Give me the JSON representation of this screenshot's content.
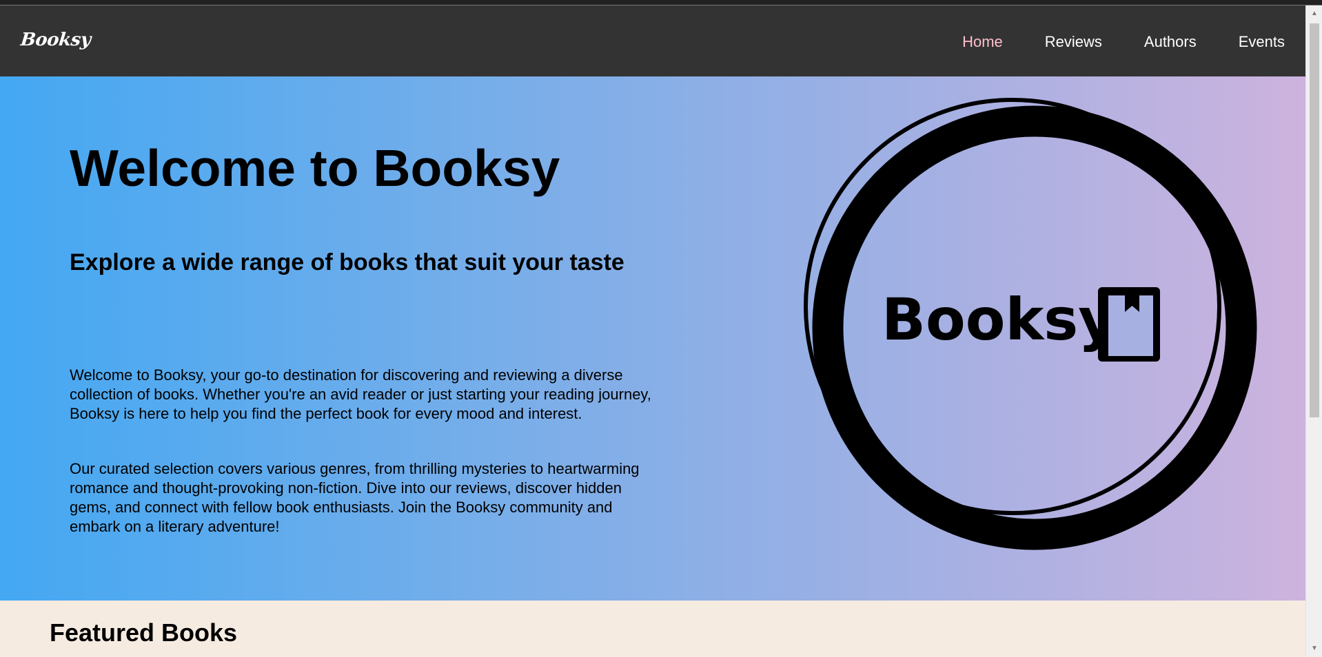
{
  "nav": {
    "brand": "Booksy",
    "links": [
      {
        "label": "Home",
        "active": true
      },
      {
        "label": "Reviews",
        "active": false
      },
      {
        "label": "Authors",
        "active": false
      },
      {
        "label": "Events",
        "active": false
      }
    ]
  },
  "hero": {
    "title": "Welcome to Booksy",
    "subtitle": "Explore a wide range of books that suit your taste",
    "paragraphs": [
      "Welcome to Booksy, your go-to destination for discovering and reviewing a diverse collection of books. Whether you're an avid reader or just starting your reading journey, Booksy is here to help you find the perfect book for every mood and interest.",
      "Our curated selection covers various genres, from thrilling mysteries to heartwarming romance and thought-provoking non-fiction. Dive into our reviews, discover hidden gems, and connect with fellow book enthusiasts. Join the Booksy community and embark on a literary adventure!"
    ],
    "logo_text": "Booksy"
  },
  "featured": {
    "title": "Featured Books"
  },
  "colors": {
    "navbar": "#333333",
    "active_link": "#ffc0cb",
    "gradient_start": "#44a8f2",
    "gradient_end": "#cdb3de",
    "featured_bg": "#f6ebe1"
  },
  "icons": {
    "logo_badge": "bookmark-book-icon",
    "scroll_up": "triangle-up-icon",
    "scroll_down": "triangle-down-icon"
  }
}
